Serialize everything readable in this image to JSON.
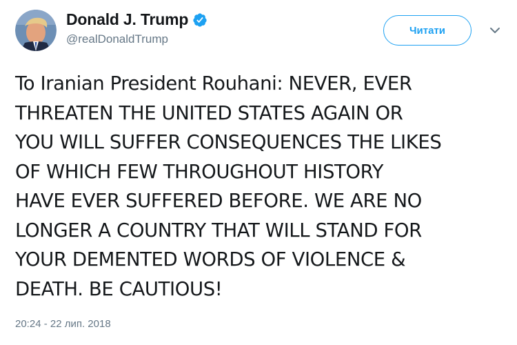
{
  "tweet": {
    "author": {
      "name": "Donald J. Trump",
      "handle": "@realDonaldTrump",
      "verified": true
    },
    "follow_button_label": "Читати",
    "text_lines": [
      "To Iranian President Rouhani: NEVER, EVER",
      "THREATEN THE UNITED STATES AGAIN OR",
      "YOU WILL SUFFER CONSEQUENCES THE LIKES",
      "OF WHICH FEW THROUGHOUT HISTORY",
      "HAVE EVER SUFFERED BEFORE. WE ARE NO",
      "LONGER A COUNTRY THAT WILL STAND FOR",
      "YOUR DEMENTED WORDS OF VIOLENCE &",
      "DEATH. BE CAUTIOUS!"
    ],
    "timestamp": "20:24 - 22 лип. 2018"
  },
  "colors": {
    "accent": "#1da1f2",
    "secondary_text": "#657786",
    "primary_text": "#14171a"
  },
  "icons": {
    "verified": "verified-badge-icon",
    "more": "chevron-down-icon"
  }
}
